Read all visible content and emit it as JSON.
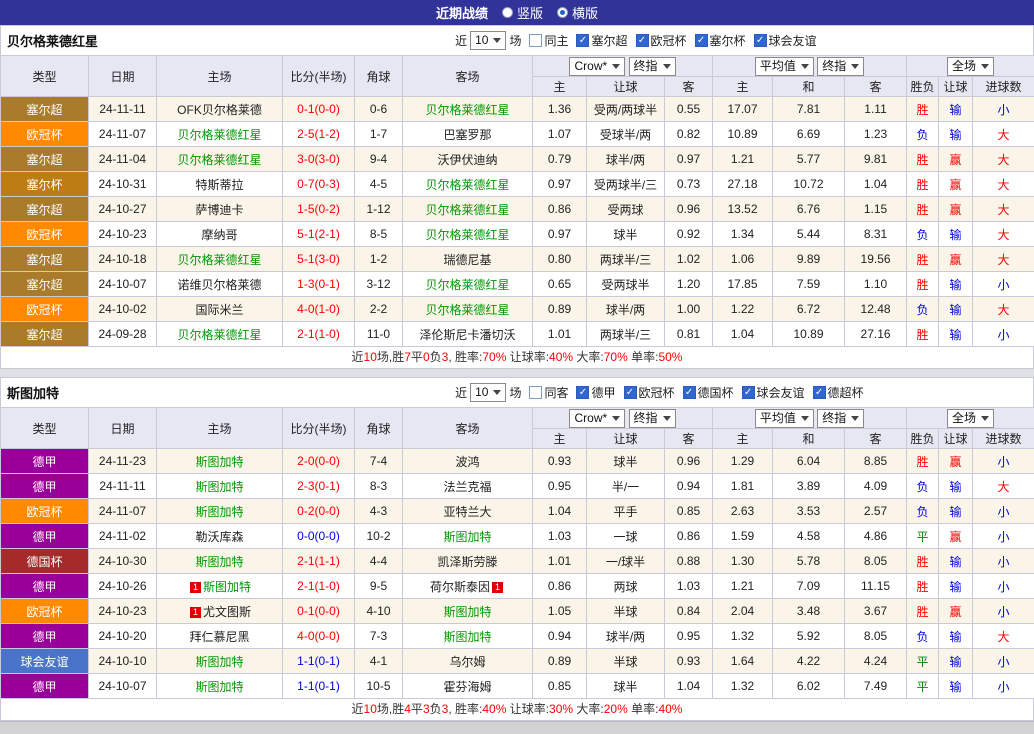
{
  "topbar": {
    "title": "近期战绩",
    "radios": [
      {
        "label": "竖版",
        "selected": false
      },
      {
        "label": "横版",
        "selected": true
      }
    ]
  },
  "columns": {
    "type": "类型",
    "date": "日期",
    "home": "主场",
    "score": "比分(半场)",
    "corner": "角球",
    "away": "客场",
    "asian_select": "Crow*",
    "asian_final_select": "终指",
    "avg_select": "平均值",
    "avg_final_select": "终指",
    "period_select": "全场",
    "sub_home": "主",
    "sub_handicap": "让球",
    "sub_away": "客",
    "sub_home2": "主",
    "sub_draw": "和",
    "sub_away2": "客",
    "result": "胜负",
    "handicap_result": "让球",
    "goals": "进球数"
  },
  "league_colors": {
    "塞尔超": "#a97b2a",
    "欧冠杯": "#ff8a00",
    "塞尔杯": "#bd7d15",
    "德甲": "#990099",
    "德国杯": "#a52a2a",
    "球会友谊": "#4a74c8"
  },
  "sections": [
    {
      "title": "贝尔格莱德红星",
      "filter": {
        "prefix": "近",
        "count": "10",
        "suffix": "场",
        "options": [
          {
            "label": "同主",
            "checked": false
          },
          {
            "label": "塞尔超",
            "checked": true
          },
          {
            "label": "欧冠杯",
            "checked": true
          },
          {
            "label": "塞尔杯",
            "checked": true
          },
          {
            "label": "球会友谊",
            "checked": true
          }
        ]
      },
      "rows": [
        {
          "league": "塞尔超",
          "date": "24-11-11",
          "home": "OFK贝尔格莱德",
          "score": "0-1(0-0)",
          "score_color": "red",
          "corner": "0-6",
          "away": "贝尔格莱德红星",
          "away_green": true,
          "asian": [
            "1.36",
            "受两/两球半",
            "0.55"
          ],
          "euro": [
            "17.07",
            "7.81",
            "1.11"
          ],
          "result": [
            "胜",
            "red"
          ],
          "handicap": [
            "输",
            "blue"
          ],
          "goals": [
            "小",
            "blue"
          ]
        },
        {
          "league": "欧冠杯",
          "date": "24-11-07",
          "home": "贝尔格莱德红星",
          "home_green": true,
          "score": "2-5(1-2)",
          "score_color": "red",
          "corner": "1-7",
          "away": "巴塞罗那",
          "asian": [
            "1.07",
            "受球半/两",
            "0.82"
          ],
          "euro": [
            "10.89",
            "6.69",
            "1.23"
          ],
          "result": [
            "负",
            "blue"
          ],
          "handicap": [
            "输",
            "blue"
          ],
          "goals": [
            "大",
            "red"
          ]
        },
        {
          "league": "塞尔超",
          "date": "24-11-04",
          "home": "贝尔格莱德红星",
          "home_green": true,
          "score": "3-0(3-0)",
          "score_color": "red",
          "corner": "9-4",
          "away": "沃伊伏迪纳",
          "asian": [
            "0.79",
            "球半/两",
            "0.97"
          ],
          "euro": [
            "1.21",
            "5.77",
            "9.81"
          ],
          "result": [
            "胜",
            "red"
          ],
          "handicap": [
            "赢",
            "red"
          ],
          "goals": [
            "大",
            "red"
          ]
        },
        {
          "league": "塞尔杯",
          "date": "24-10-31",
          "home": "特斯蒂拉",
          "score": "0-7(0-3)",
          "score_color": "red",
          "corner": "4-5",
          "away": "贝尔格莱德红星",
          "away_green": true,
          "asian": [
            "0.97",
            "受两球半/三",
            "0.73"
          ],
          "euro": [
            "27.18",
            "10.72",
            "1.04"
          ],
          "result": [
            "胜",
            "red"
          ],
          "handicap": [
            "赢",
            "red"
          ],
          "goals": [
            "大",
            "red"
          ]
        },
        {
          "league": "塞尔超",
          "date": "24-10-27",
          "home": "萨博迪卡",
          "score": "1-5(0-2)",
          "score_color": "red",
          "corner": "1-12",
          "away": "贝尔格莱德红星",
          "away_green": true,
          "asian": [
            "0.86",
            "受两球",
            "0.96"
          ],
          "euro": [
            "13.52",
            "6.76",
            "1.15"
          ],
          "result": [
            "胜",
            "red"
          ],
          "handicap": [
            "赢",
            "red"
          ],
          "goals": [
            "大",
            "red"
          ]
        },
        {
          "league": "欧冠杯",
          "date": "24-10-23",
          "home": "摩纳哥",
          "score": "5-1(2-1)",
          "score_color": "red",
          "corner": "8-5",
          "away": "贝尔格莱德红星",
          "away_green": true,
          "asian": [
            "0.97",
            "球半",
            "0.92"
          ],
          "euro": [
            "1.34",
            "5.44",
            "8.31"
          ],
          "result": [
            "负",
            "blue"
          ],
          "handicap": [
            "输",
            "blue"
          ],
          "goals": [
            "大",
            "red"
          ]
        },
        {
          "league": "塞尔超",
          "date": "24-10-18",
          "home": "贝尔格莱德红星",
          "home_green": true,
          "score": "5-1(3-0)",
          "score_color": "red",
          "corner": "1-2",
          "away": "瑞德尼基",
          "asian": [
            "0.80",
            "两球半/三",
            "1.02"
          ],
          "euro": [
            "1.06",
            "9.89",
            "19.56"
          ],
          "result": [
            "胜",
            "red"
          ],
          "handicap": [
            "赢",
            "red"
          ],
          "goals": [
            "大",
            "red"
          ]
        },
        {
          "league": "塞尔超",
          "date": "24-10-07",
          "home": "诺维贝尔格莱德",
          "score": "1-3(0-1)",
          "score_color": "red",
          "corner": "3-12",
          "away": "贝尔格莱德红星",
          "away_green": true,
          "asian": [
            "0.65",
            "受两球半",
            "1.20"
          ],
          "euro": [
            "17.85",
            "7.59",
            "1.10"
          ],
          "result": [
            "胜",
            "red"
          ],
          "handicap": [
            "输",
            "blue"
          ],
          "goals": [
            "小",
            "blue"
          ]
        },
        {
          "league": "欧冠杯",
          "date": "24-10-02",
          "home": "国际米兰",
          "score": "4-0(1-0)",
          "score_color": "red",
          "corner": "2-2",
          "away": "贝尔格莱德红星",
          "away_green": true,
          "asian": [
            "0.89",
            "球半/两",
            "1.00"
          ],
          "euro": [
            "1.22",
            "6.72",
            "12.48"
          ],
          "result": [
            "负",
            "blue"
          ],
          "handicap": [
            "输",
            "blue"
          ],
          "goals": [
            "大",
            "red"
          ]
        },
        {
          "league": "塞尔超",
          "date": "24-09-28",
          "home": "贝尔格莱德红星",
          "home_green": true,
          "score": "2-1(1-0)",
          "score_color": "red",
          "corner": "11-0",
          "away": "泽伦斯尼卡潘切沃",
          "asian": [
            "1.01",
            "两球半/三",
            "0.81"
          ],
          "euro": [
            "1.04",
            "10.89",
            "27.16"
          ],
          "result": [
            "胜",
            "red"
          ],
          "handicap": [
            "输",
            "blue"
          ],
          "goals": [
            "小",
            "blue"
          ]
        }
      ],
      "summary": [
        {
          "text": "近",
          "red": false
        },
        {
          "text": "10",
          "red": true
        },
        {
          "text": "场,胜",
          "red": false
        },
        {
          "text": "7",
          "red": true
        },
        {
          "text": "平",
          "red": false
        },
        {
          "text": "0",
          "red": true
        },
        {
          "text": "负",
          "red": false
        },
        {
          "text": "3",
          "red": true
        },
        {
          "text": ", 胜率:",
          "red": false
        },
        {
          "text": "70%",
          "red": true
        },
        {
          "text": " 让球率:",
          "red": false
        },
        {
          "text": "40%",
          "red": true
        },
        {
          "text": " 大率:",
          "red": false
        },
        {
          "text": "70%",
          "red": true
        },
        {
          "text": " 单率:",
          "red": false
        },
        {
          "text": "50%",
          "red": true
        }
      ]
    },
    {
      "title": "斯图加特",
      "filter": {
        "prefix": "近",
        "count": "10",
        "suffix": "场",
        "options": [
          {
            "label": "同客",
            "checked": false
          },
          {
            "label": "德甲",
            "checked": true
          },
          {
            "label": "欧冠杯",
            "checked": true
          },
          {
            "label": "德国杯",
            "checked": true
          },
          {
            "label": "球会友谊",
            "checked": true
          },
          {
            "label": "德超杯",
            "checked": true
          }
        ]
      },
      "rows": [
        {
          "league": "德甲",
          "date": "24-11-23",
          "home": "斯图加特",
          "home_green": true,
          "score": "2-0(0-0)",
          "score_color": "red",
          "corner": "7-4",
          "away": "波鸿",
          "asian": [
            "0.93",
            "球半",
            "0.96"
          ],
          "euro": [
            "1.29",
            "6.04",
            "8.85"
          ],
          "result": [
            "胜",
            "red"
          ],
          "handicap": [
            "赢",
            "red"
          ],
          "goals": [
            "小",
            "blue"
          ]
        },
        {
          "league": "德甲",
          "date": "24-11-11",
          "home": "斯图加特",
          "home_green": true,
          "score": "2-3(0-1)",
          "score_color": "red",
          "corner": "8-3",
          "away": "法兰克福",
          "asian": [
            "0.95",
            "半/一",
            "0.94"
          ],
          "euro": [
            "1.81",
            "3.89",
            "4.09"
          ],
          "result": [
            "负",
            "blue"
          ],
          "handicap": [
            "输",
            "blue"
          ],
          "goals": [
            "大",
            "red"
          ]
        },
        {
          "league": "欧冠杯",
          "date": "24-11-07",
          "home": "斯图加特",
          "home_green": true,
          "score": "0-2(0-0)",
          "score_color": "red",
          "corner": "4-3",
          "away": "亚特兰大",
          "asian": [
            "1.04",
            "平手",
            "0.85"
          ],
          "euro": [
            "2.63",
            "3.53",
            "2.57"
          ],
          "result": [
            "负",
            "blue"
          ],
          "handicap": [
            "输",
            "blue"
          ],
          "goals": [
            "小",
            "blue"
          ]
        },
        {
          "league": "德甲",
          "date": "24-11-02",
          "home": "勒沃库森",
          "score": "0-0(0-0)",
          "score_color": "blue",
          "corner": "10-2",
          "away": "斯图加特",
          "away_green": true,
          "asian": [
            "1.03",
            "一球",
            "0.86"
          ],
          "euro": [
            "1.59",
            "4.58",
            "4.86"
          ],
          "result": [
            "平",
            "green"
          ],
          "handicap": [
            "赢",
            "red"
          ],
          "goals": [
            "小",
            "blue"
          ]
        },
        {
          "league": "德国杯",
          "date": "24-10-30",
          "home": "斯图加特",
          "home_green": true,
          "score": "2-1(1-1)",
          "score_color": "red",
          "corner": "4-4",
          "away": "凯泽斯劳滕",
          "asian": [
            "1.01",
            "一/球半",
            "0.88"
          ],
          "euro": [
            "1.30",
            "5.78",
            "8.05"
          ],
          "result": [
            "胜",
            "red"
          ],
          "handicap": [
            "输",
            "blue"
          ],
          "goals": [
            "小",
            "blue"
          ]
        },
        {
          "league": "德甲",
          "date": "24-10-26",
          "home": "斯图加特",
          "home_green": true,
          "home_card": "1",
          "score": "2-1(1-0)",
          "score_color": "red",
          "corner": "9-5",
          "away": "荷尔斯泰因",
          "away_card": "1",
          "asian": [
            "0.86",
            "两球",
            "1.03"
          ],
          "euro": [
            "1.21",
            "7.09",
            "11.15"
          ],
          "result": [
            "胜",
            "red"
          ],
          "handicap": [
            "输",
            "blue"
          ],
          "goals": [
            "小",
            "blue"
          ]
        },
        {
          "league": "欧冠杯",
          "date": "24-10-23",
          "home": "尤文图斯",
          "home_card": "1",
          "score": "0-1(0-0)",
          "score_color": "red",
          "corner": "4-10",
          "away": "斯图加特",
          "away_green": true,
          "asian": [
            "1.05",
            "半球",
            "0.84"
          ],
          "euro": [
            "2.04",
            "3.48",
            "3.67"
          ],
          "result": [
            "胜",
            "red"
          ],
          "handicap": [
            "赢",
            "red"
          ],
          "goals": [
            "小",
            "blue"
          ]
        },
        {
          "league": "德甲",
          "date": "24-10-20",
          "home": "拜仁慕尼黑",
          "score": "4-0(0-0)",
          "score_color": "red",
          "corner": "7-3",
          "away": "斯图加特",
          "away_green": true,
          "asian": [
            "0.94",
            "球半/两",
            "0.95"
          ],
          "euro": [
            "1.32",
            "5.92",
            "8.05"
          ],
          "result": [
            "负",
            "blue"
          ],
          "handicap": [
            "输",
            "blue"
          ],
          "goals": [
            "大",
            "red"
          ]
        },
        {
          "league": "球会友谊",
          "date": "24-10-10",
          "home": "斯图加特",
          "home_green": true,
          "score": "1-1(0-1)",
          "score_color": "blue",
          "corner": "4-1",
          "away": "乌尔姆",
          "asian": [
            "0.89",
            "半球",
            "0.93"
          ],
          "euro": [
            "1.64",
            "4.22",
            "4.24"
          ],
          "result": [
            "平",
            "green"
          ],
          "handicap": [
            "输",
            "blue"
          ],
          "goals": [
            "小",
            "blue"
          ]
        },
        {
          "league": "德甲",
          "date": "24-10-07",
          "home": "斯图加特",
          "home_green": true,
          "score": "1-1(0-1)",
          "score_color": "blue",
          "corner": "10-5",
          "away": "霍芬海姆",
          "asian": [
            "0.85",
            "球半",
            "1.04"
          ],
          "euro": [
            "1.32",
            "6.02",
            "7.49"
          ],
          "result": [
            "平",
            "green"
          ],
          "handicap": [
            "输",
            "blue"
          ],
          "goals": [
            "小",
            "blue"
          ]
        }
      ],
      "summary": [
        {
          "text": "近",
          "red": false
        },
        {
          "text": "10",
          "red": true
        },
        {
          "text": "场,胜",
          "red": false
        },
        {
          "text": "4",
          "red": true
        },
        {
          "text": "平",
          "red": false
        },
        {
          "text": "3",
          "red": true
        },
        {
          "text": "负",
          "red": false
        },
        {
          "text": "3",
          "red": true
        },
        {
          "text": ", 胜率:",
          "red": false
        },
        {
          "text": "40%",
          "red": true
        },
        {
          "text": " 让球率:",
          "red": false
        },
        {
          "text": "30%",
          "red": true
        },
        {
          "text": " 大率:",
          "red": false
        },
        {
          "text": "20%",
          "red": true
        },
        {
          "text": " 单率:",
          "red": false
        },
        {
          "text": "40%",
          "red": true
        }
      ]
    }
  ]
}
